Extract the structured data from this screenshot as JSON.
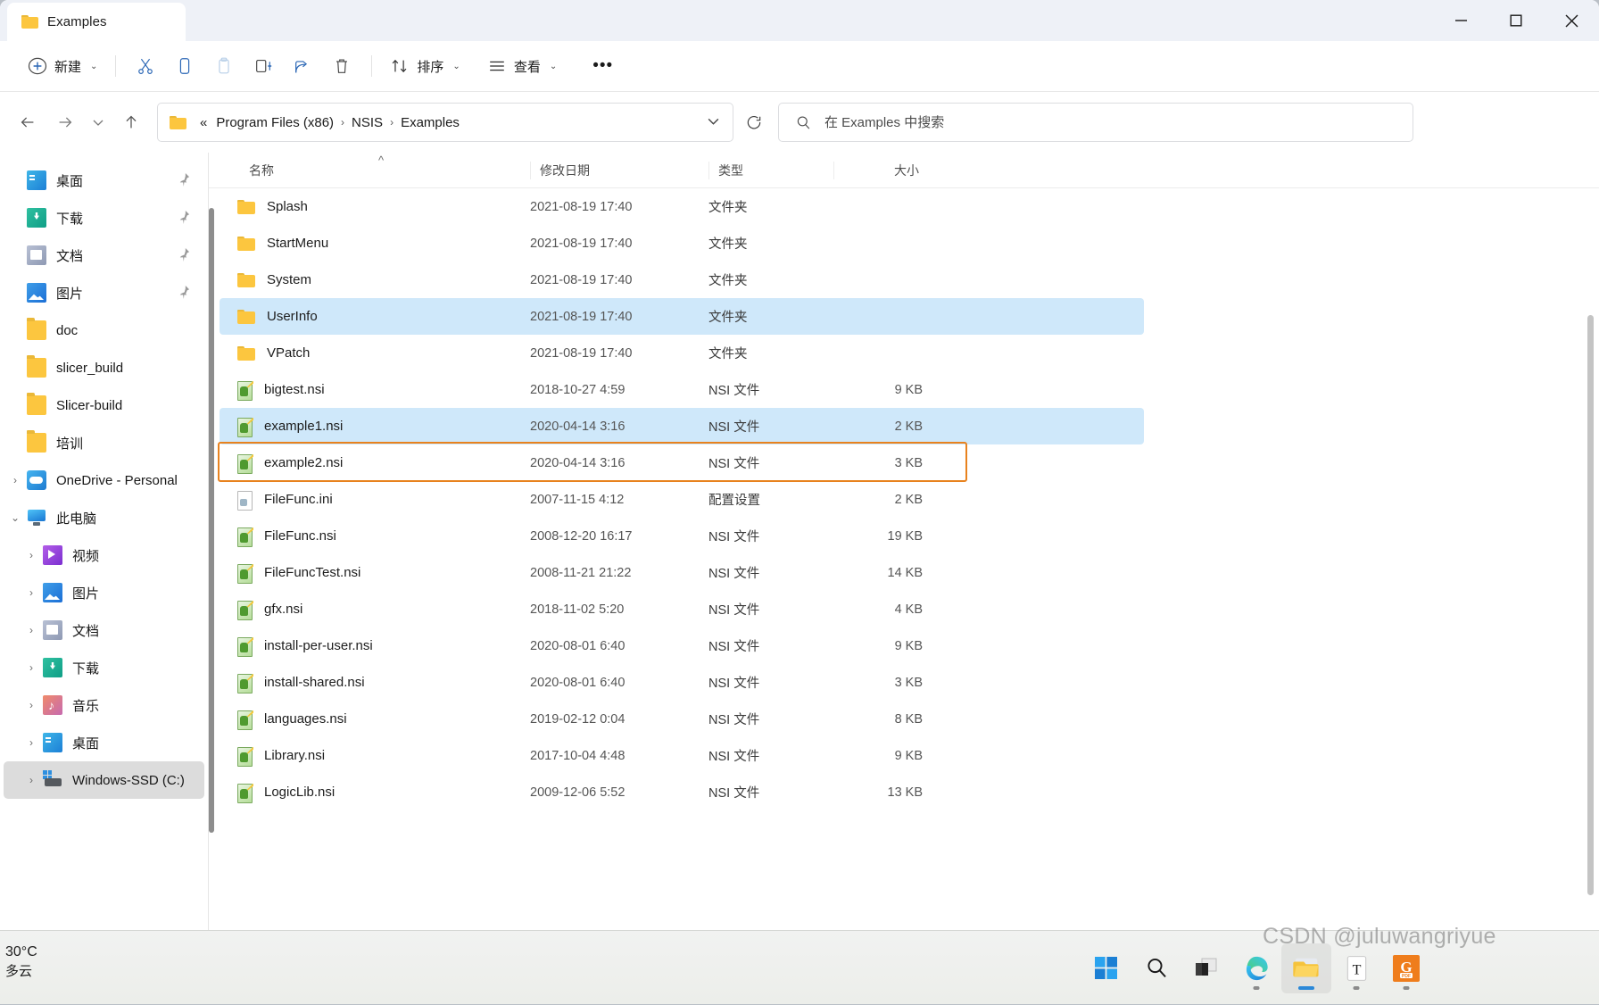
{
  "window": {
    "tab_title": "Examples",
    "minimize_label": "—",
    "maximize_label": "□",
    "close_label": "✕"
  },
  "command_bar": {
    "new_label": "新建",
    "sort_label": "排序",
    "view_label": "查看",
    "more_label": "•••",
    "icons": [
      "cut-icon",
      "copy-icon",
      "paste-icon",
      "rename-icon",
      "share-icon",
      "delete-icon"
    ]
  },
  "nav": {
    "back_label": "←",
    "forward_label": "→",
    "recent_label": "⌄",
    "up_label": "↑",
    "breadcrumbs": [
      "«",
      "Program Files (x86)",
      "NSIS",
      "Examples"
    ],
    "refresh_label": "⟳"
  },
  "search": {
    "placeholder": "在 Examples 中搜索",
    "value": ""
  },
  "sidebar": {
    "items": [
      {
        "label": "桌面",
        "icon": "desktop-icon",
        "indent": 0,
        "chevron": "",
        "pinned": true,
        "selected": false
      },
      {
        "label": "下载",
        "icon": "download-icon",
        "indent": 0,
        "chevron": "",
        "pinned": true,
        "selected": false
      },
      {
        "label": "文档",
        "icon": "documents-icon",
        "indent": 0,
        "chevron": "",
        "pinned": true,
        "selected": false
      },
      {
        "label": "图片",
        "icon": "pictures-icon",
        "indent": 0,
        "chevron": "",
        "pinned": true,
        "selected": false
      },
      {
        "label": "doc",
        "icon": "folder-icon",
        "indent": 0,
        "chevron": "",
        "pinned": false,
        "selected": false
      },
      {
        "label": "slicer_build",
        "icon": "folder-icon",
        "indent": 0,
        "chevron": "",
        "pinned": false,
        "selected": false
      },
      {
        "label": "Slicer-build",
        "icon": "folder-icon",
        "indent": 0,
        "chevron": "",
        "pinned": false,
        "selected": false
      },
      {
        "label": "培训",
        "icon": "folder-icon",
        "indent": 0,
        "chevron": "",
        "pinned": false,
        "selected": false
      },
      {
        "label": "OneDrive - Personal",
        "icon": "onedrive-icon",
        "indent": 0,
        "chevron": "›",
        "pinned": false,
        "selected": false
      },
      {
        "label": "此电脑",
        "icon": "thispc-icon",
        "indent": 0,
        "chevron": "⌄",
        "pinned": false,
        "selected": false
      },
      {
        "label": "视频",
        "icon": "videos-icon",
        "indent": 1,
        "chevron": "›",
        "pinned": false,
        "selected": false
      },
      {
        "label": "图片",
        "icon": "pictures-icon",
        "indent": 1,
        "chevron": "›",
        "pinned": false,
        "selected": false
      },
      {
        "label": "文档",
        "icon": "documents-icon",
        "indent": 1,
        "chevron": "›",
        "pinned": false,
        "selected": false
      },
      {
        "label": "下载",
        "icon": "download-icon",
        "indent": 1,
        "chevron": "›",
        "pinned": false,
        "selected": false
      },
      {
        "label": "音乐",
        "icon": "music-icon",
        "indent": 1,
        "chevron": "›",
        "pinned": false,
        "selected": false
      },
      {
        "label": "桌面",
        "icon": "desktop-icon",
        "indent": 1,
        "chevron": "›",
        "pinned": false,
        "selected": false
      },
      {
        "label": "Windows-SSD (C:)",
        "icon": "drive-icon",
        "indent": 1,
        "chevron": "›",
        "pinned": false,
        "selected": true
      }
    ]
  },
  "file_list": {
    "columns": [
      {
        "key": "name",
        "label": "名称",
        "sorted": true
      },
      {
        "key": "date",
        "label": "修改日期",
        "sorted": false
      },
      {
        "key": "type",
        "label": "类型",
        "sorted": false
      },
      {
        "key": "size",
        "label": "大小",
        "sorted": false
      }
    ],
    "sort_indicator": "^",
    "rows": [
      {
        "name": "Splash",
        "date": "2021-08-19 17:40",
        "type": "文件夹",
        "size": "",
        "icon": "folder-icon",
        "selected": false,
        "focused": false
      },
      {
        "name": "StartMenu",
        "date": "2021-08-19 17:40",
        "type": "文件夹",
        "size": "",
        "icon": "folder-icon",
        "selected": false,
        "focused": false
      },
      {
        "name": "System",
        "date": "2021-08-19 17:40",
        "type": "文件夹",
        "size": "",
        "icon": "folder-icon",
        "selected": false,
        "focused": false
      },
      {
        "name": "UserInfo",
        "date": "2021-08-19 17:40",
        "type": "文件夹",
        "size": "",
        "icon": "folder-icon",
        "selected": true,
        "focused": false
      },
      {
        "name": "VPatch",
        "date": "2021-08-19 17:40",
        "type": "文件夹",
        "size": "",
        "icon": "folder-icon",
        "selected": false,
        "focused": false
      },
      {
        "name": "bigtest.nsi",
        "date": "2018-10-27 4:59",
        "type": "NSI 文件",
        "size": "9 KB",
        "icon": "nsi-file-icon",
        "selected": false,
        "focused": false
      },
      {
        "name": "example1.nsi",
        "date": "2020-04-14 3:16",
        "type": "NSI 文件",
        "size": "2 KB",
        "icon": "nsi-file-icon",
        "selected": true,
        "focused": true
      },
      {
        "name": "example2.nsi",
        "date": "2020-04-14 3:16",
        "type": "NSI 文件",
        "size": "3 KB",
        "icon": "nsi-file-icon",
        "selected": false,
        "focused": false
      },
      {
        "name": "FileFunc.ini",
        "date": "2007-11-15 4:12",
        "type": "配置设置",
        "size": "2 KB",
        "icon": "ini-file-icon",
        "selected": false,
        "focused": false
      },
      {
        "name": "FileFunc.nsi",
        "date": "2008-12-20 16:17",
        "type": "NSI 文件",
        "size": "19 KB",
        "icon": "nsi-file-icon",
        "selected": false,
        "focused": false
      },
      {
        "name": "FileFuncTest.nsi",
        "date": "2008-11-21 21:22",
        "type": "NSI 文件",
        "size": "14 KB",
        "icon": "nsi-file-icon",
        "selected": false,
        "focused": false
      },
      {
        "name": "gfx.nsi",
        "date": "2018-11-02 5:20",
        "type": "NSI 文件",
        "size": "4 KB",
        "icon": "nsi-file-icon",
        "selected": false,
        "focused": false
      },
      {
        "name": "install-per-user.nsi",
        "date": "2020-08-01 6:40",
        "type": "NSI 文件",
        "size": "9 KB",
        "icon": "nsi-file-icon",
        "selected": false,
        "focused": false
      },
      {
        "name": "install-shared.nsi",
        "date": "2020-08-01 6:40",
        "type": "NSI 文件",
        "size": "3 KB",
        "icon": "nsi-file-icon",
        "selected": false,
        "focused": false
      },
      {
        "name": "languages.nsi",
        "date": "2019-02-12 0:04",
        "type": "NSI 文件",
        "size": "8 KB",
        "icon": "nsi-file-icon",
        "selected": false,
        "focused": false
      },
      {
        "name": "Library.nsi",
        "date": "2017-10-04 4:48",
        "type": "NSI 文件",
        "size": "9 KB",
        "icon": "nsi-file-icon",
        "selected": false,
        "focused": false
      },
      {
        "name": "LogicLib.nsi",
        "date": "2009-12-06 5:52",
        "type": "NSI 文件",
        "size": "13 KB",
        "icon": "nsi-file-icon",
        "selected": false,
        "focused": false
      }
    ]
  },
  "taskbar": {
    "weather_temp": "30°C",
    "weather_desc": "多云",
    "items": [
      {
        "name": "start-button",
        "icon": "windows-logo-icon"
      },
      {
        "name": "search-button",
        "icon": "search-icon"
      },
      {
        "name": "task-view-button",
        "icon": "task-view-icon"
      },
      {
        "name": "edge-button",
        "icon": "edge-icon"
      },
      {
        "name": "file-explorer-button",
        "icon": "file-explorer-icon"
      },
      {
        "name": "text-editor-button",
        "icon": "text-document-icon"
      },
      {
        "name": "pdf-app-button",
        "icon": "gpdf-icon"
      }
    ]
  },
  "watermark": "CSDN @juluwangriyue",
  "colors": {
    "selection_blue": "#cfe8fa",
    "focus_orange": "#e8821e",
    "accent_blue": "#2b88d8",
    "titlebar_bg": "#eef1f7"
  }
}
